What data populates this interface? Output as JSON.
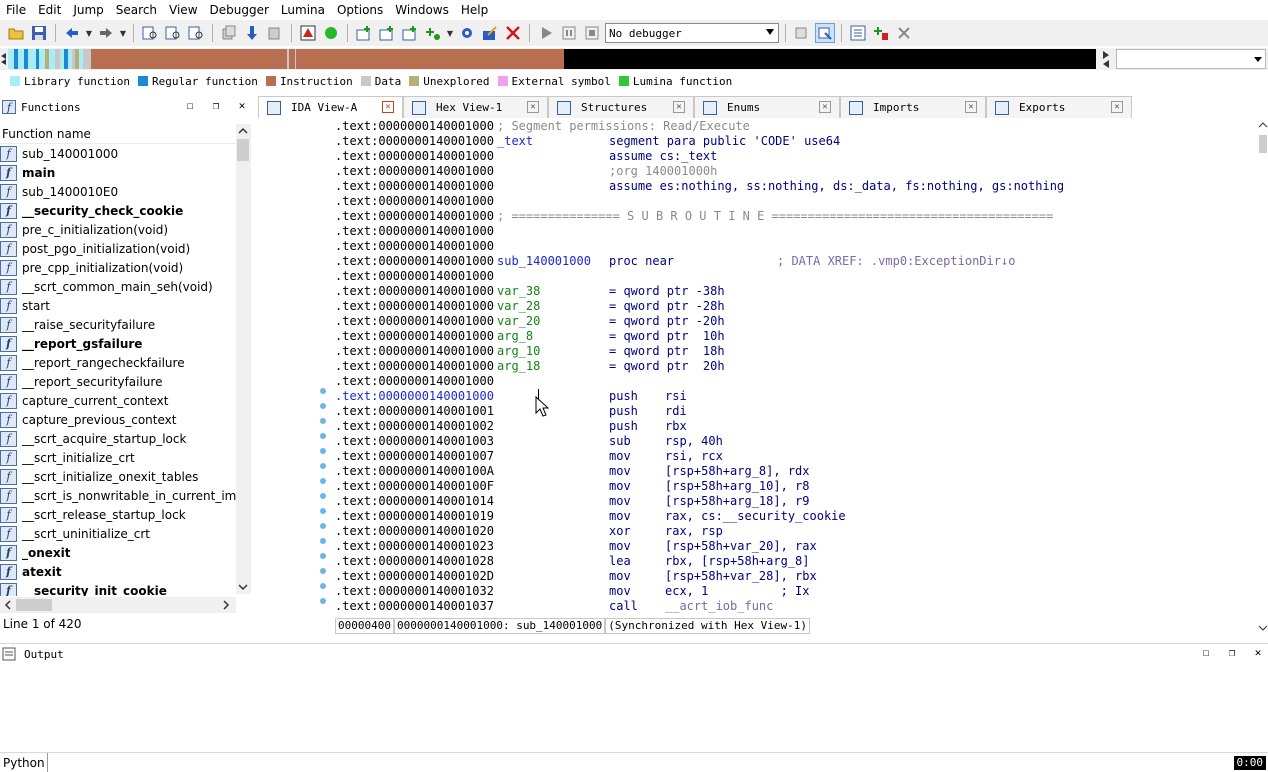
{
  "menu": [
    "File",
    "Edit",
    "Jump",
    "Search",
    "View",
    "Debugger",
    "Lumina",
    "Options",
    "Windows",
    "Help"
  ],
  "debugger_select": "No debugger",
  "legend": [
    {
      "label": "Library function",
      "color": "#a8ecf6"
    },
    {
      "label": "Regular function",
      "color": "#1a8ad8"
    },
    {
      "label": "Instruction",
      "color": "#b86e50"
    },
    {
      "label": "Data",
      "color": "#c8c8c8"
    },
    {
      "label": "Unexplored",
      "color": "#b4b078"
    },
    {
      "label": "External symbol",
      "color": "#f0a0f0"
    },
    {
      "label": "Lumina function",
      "color": "#30c830"
    }
  ],
  "functions_panel": {
    "title": "Functions",
    "column_header": "Function name",
    "status": "Line 1 of 420",
    "items": [
      {
        "name": "sub_140001000",
        "bold": false
      },
      {
        "name": "main",
        "bold": true
      },
      {
        "name": "sub_1400010E0",
        "bold": false
      },
      {
        "name": "__security_check_cookie",
        "bold": true
      },
      {
        "name": "pre_c_initialization(void)",
        "bold": false
      },
      {
        "name": "post_pgo_initialization(void)",
        "bold": false
      },
      {
        "name": "pre_cpp_initialization(void)",
        "bold": false
      },
      {
        "name": "__scrt_common_main_seh(void)",
        "bold": false
      },
      {
        "name": "start",
        "bold": false
      },
      {
        "name": "__raise_securityfailure",
        "bold": false
      },
      {
        "name": "__report_gsfailure",
        "bold": true
      },
      {
        "name": "__report_rangecheckfailure",
        "bold": false
      },
      {
        "name": "__report_securityfailure",
        "bold": false
      },
      {
        "name": "capture_current_context",
        "bold": false
      },
      {
        "name": "capture_previous_context",
        "bold": false
      },
      {
        "name": "__scrt_acquire_startup_lock",
        "bold": false
      },
      {
        "name": "__scrt_initialize_crt",
        "bold": false
      },
      {
        "name": "__scrt_initialize_onexit_tables",
        "bold": false
      },
      {
        "name": "__scrt_is_nonwritable_in_current_image",
        "bold": false
      },
      {
        "name": "__scrt_release_startup_lock",
        "bold": false
      },
      {
        "name": "__scrt_uninitialize_crt",
        "bold": false
      },
      {
        "name": "_onexit",
        "bold": true
      },
      {
        "name": "atexit",
        "bold": true
      },
      {
        "name": "__security_init_cookie",
        "bold": true
      }
    ]
  },
  "tabs": [
    {
      "label": "IDA View-A",
      "active": true
    },
    {
      "label": "Hex View-1",
      "active": false
    },
    {
      "label": "Structures",
      "active": false
    },
    {
      "label": "Enums",
      "active": false
    },
    {
      "label": "Imports",
      "active": false
    },
    {
      "label": "Exports",
      "active": false
    }
  ],
  "disasm_lines": [
    {
      "addr": ".text:0000000140001000",
      "a": "; Segment permissions: Read/Execute",
      "a_cls": "grey"
    },
    {
      "addr": ".text:0000000140001000",
      "a": "_text",
      "a_cls": "blue",
      "b": "segment para public 'CODE' use64",
      "b_cls": "navy"
    },
    {
      "addr": ".text:0000000140001000",
      "b": "assume cs:_text",
      "b_cls": "navy"
    },
    {
      "addr": ".text:0000000140001000",
      "b": ";org 140001000h",
      "b_cls": "grey"
    },
    {
      "addr": ".text:0000000140001000",
      "b": "assume es:nothing, ss:nothing, ds:_data, fs:nothing, gs:nothing",
      "b_cls": "navy"
    },
    {
      "addr": ".text:0000000140001000"
    },
    {
      "addr": ".text:0000000140001000",
      "a": "; =============== S U B R O U T I N E =======================================",
      "a_cls": "grey"
    },
    {
      "addr": ".text:0000000140001000"
    },
    {
      "addr": ".text:0000000140001000"
    },
    {
      "addr": ".text:0000000140001000",
      "a": "sub_140001000",
      "a_cls": "blue",
      "b": "proc near",
      "b_cls": "navy",
      "r": "; DATA XREF: .vmp0:ExceptionDir↓o",
      "r_cls": "purple"
    },
    {
      "addr": ".text:0000000140001000"
    },
    {
      "addr": ".text:0000000140001000",
      "a": "var_38",
      "a_cls": "green",
      "b": "= qword ptr -38h",
      "b_cls": "navy"
    },
    {
      "addr": ".text:0000000140001000",
      "a": "var_28",
      "a_cls": "green",
      "b": "= qword ptr -28h",
      "b_cls": "navy"
    },
    {
      "addr": ".text:0000000140001000",
      "a": "var_20",
      "a_cls": "green",
      "b": "= qword ptr -20h",
      "b_cls": "navy"
    },
    {
      "addr": ".text:0000000140001000",
      "a": "arg_8",
      "a_cls": "green",
      "b": "= qword ptr  10h",
      "b_cls": "navy"
    },
    {
      "addr": ".text:0000000140001000",
      "a": "arg_10",
      "a_cls": "green",
      "b": "= qword ptr  18h",
      "b_cls": "navy"
    },
    {
      "addr": ".text:0000000140001000",
      "a": "arg_18",
      "a_cls": "green",
      "b": "= qword ptr  20h",
      "b_cls": "navy"
    },
    {
      "addr": ".text:0000000140001000"
    },
    {
      "addr": ".text:0000000140001000",
      "cur": true,
      "b": "push",
      "b_cls": "navy",
      "c": "rsi",
      "c_cls": "navy"
    },
    {
      "addr": ".text:0000000140001001",
      "b": "push",
      "b_cls": "navy",
      "c": "rdi",
      "c_cls": "navy"
    },
    {
      "addr": ".text:0000000140001002",
      "b": "push",
      "b_cls": "navy",
      "c": "rbx",
      "c_cls": "navy"
    },
    {
      "addr": ".text:0000000140001003",
      "b": "sub",
      "b_cls": "navy",
      "c": "rsp, 40h",
      "c_cls": "navy"
    },
    {
      "addr": ".text:0000000140001007",
      "b": "mov",
      "b_cls": "navy",
      "c": "rsi, rcx",
      "c_cls": "navy"
    },
    {
      "addr": ".text:000000014000100A",
      "b": "mov",
      "b_cls": "navy",
      "c": "[rsp+58h+arg_8], rdx",
      "c_cls": "navy"
    },
    {
      "addr": ".text:000000014000100F",
      "b": "mov",
      "b_cls": "navy",
      "c": "[rsp+58h+arg_10], r8",
      "c_cls": "navy"
    },
    {
      "addr": ".text:0000000140001014",
      "b": "mov",
      "b_cls": "navy",
      "c": "[rsp+58h+arg_18], r9",
      "c_cls": "navy"
    },
    {
      "addr": ".text:0000000140001019",
      "b": "mov",
      "b_cls": "navy",
      "c": "rax, cs:__security_cookie",
      "c_cls": "navy"
    },
    {
      "addr": ".text:0000000140001020",
      "b": "xor",
      "b_cls": "navy",
      "c": "rax, rsp",
      "c_cls": "navy"
    },
    {
      "addr": ".text:0000000140001023",
      "b": "mov",
      "b_cls": "navy",
      "c": "[rsp+58h+var_20], rax",
      "c_cls": "navy"
    },
    {
      "addr": ".text:0000000140001028",
      "b": "lea",
      "b_cls": "navy",
      "c": "rbx, [rsp+58h+arg_8]",
      "c_cls": "navy"
    },
    {
      "addr": ".text:000000014000102D",
      "b": "mov",
      "b_cls": "navy",
      "c": "[rsp+58h+var_28], rbx",
      "c_cls": "navy"
    },
    {
      "addr": ".text:0000000140001032",
      "b": "mov",
      "b_cls": "navy",
      "c": "ecx, 1          ; Ix",
      "c_cls": "navy"
    },
    {
      "addr": ".text:0000000140001037",
      "b": "call",
      "b_cls": "navy",
      "c": "__acrt_iob_func",
      "c_cls": "purple"
    }
  ],
  "disasm_status": {
    "offset": "00000400",
    "location": "0000000140001000: sub_140001000",
    "sync": "(Synchronized with Hex View-1)"
  },
  "output_panel": {
    "title": "Output"
  },
  "python_label": "Python",
  "clock": "0:00"
}
